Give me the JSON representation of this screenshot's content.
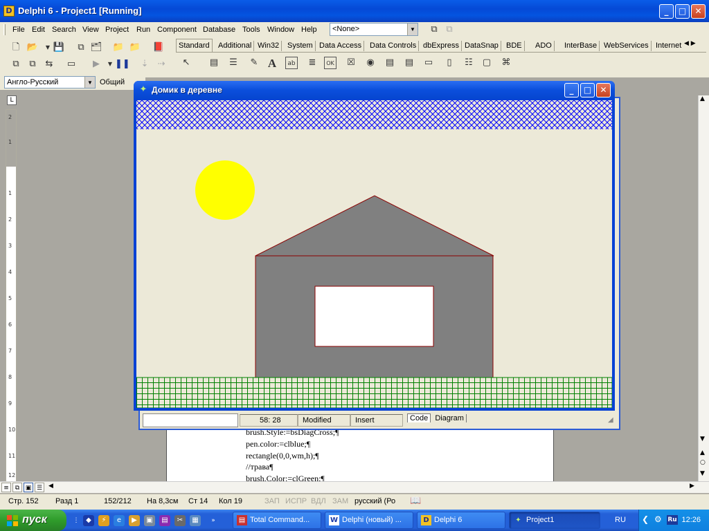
{
  "ide": {
    "title": "Delphi 6 - Project1 [Running]",
    "menu": [
      "File",
      "Edit",
      "Search",
      "View",
      "Project",
      "Run",
      "Component",
      "Database",
      "Tools",
      "Window",
      "Help"
    ],
    "combo_value": "<None>",
    "palette_tabs": [
      "Standard",
      "Additional",
      "Win32",
      "System",
      "Data Access",
      "Data Controls",
      "dbExpress",
      "DataSnap",
      "BDE",
      "ADO",
      "InterBase",
      "WebServices",
      "Internet"
    ]
  },
  "word": {
    "dictionary_value": "Англо-Русский",
    "style_value": "Общий",
    "code_lines": [
      "brush.Style:=bsDiagCross;¶",
      "pen.color:=clblue;¶",
      "rectangle(0,0,wm,h);¶",
      "//трава¶",
      "brush.Color:=clGreen;¶"
    ],
    "ruler_numbers": [
      "2",
      "1",
      "1",
      "1",
      "2",
      "3",
      "4",
      "5",
      "6",
      "7",
      "8",
      "9",
      "10",
      "11",
      "12"
    ],
    "status": {
      "page": "Стр. 152",
      "section": "Разд 1",
      "pages": "152/212",
      "at": "На 8,3см",
      "line": "Ст 14",
      "col": "Кол 19",
      "rec": "ЗАП",
      "trk": "ИСПР",
      "ext": "ВДЛ",
      "ovr": "ЗАМ",
      "language": "русский (Ро"
    }
  },
  "editor": {
    "cursor_pos": "58: 28",
    "modified": "Modified",
    "mode": "Insert",
    "tab_code": "Code",
    "tab_diagram": "Diagram"
  },
  "form": {
    "title": "Домик в деревне",
    "colors": {
      "background": "#ece9d8",
      "sky_hatch": "#0000ff",
      "sun": "#ffff00",
      "house": "#808080",
      "outline": "#8b0000",
      "window": "#ffffff",
      "grass_hatch": "#008000"
    }
  },
  "taskbar": {
    "start_label": "пуск",
    "tasks": [
      "Total Command...",
      "Delphi (новый) ...",
      "Delphi 6",
      "Project1"
    ],
    "language": "RU",
    "tray_lang_icon": "Ru",
    "clock": "12:26"
  }
}
